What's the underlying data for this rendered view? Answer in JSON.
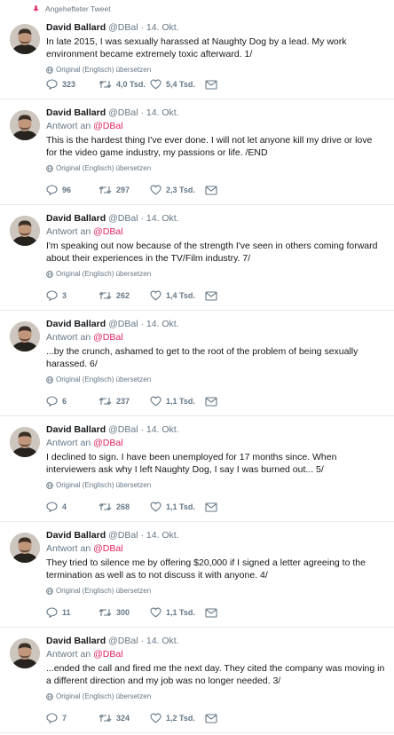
{
  "pinned_label": "Angehefteter Tweet",
  "reply_prefix": "Antwort an",
  "translate_label": "Original (Englisch) übersetzen",
  "accent_color": "#e0245e",
  "tweets": [
    {
      "name": "David Ballard",
      "meta": "@DBal · 14. Okt.",
      "reply_to": "",
      "text": "In late 2015, I was sexually harassed at Naughty Dog by a lead. My work environment became extremely toxic afterward. 1/",
      "replies": "323",
      "retweets": "4,0 Tsd.",
      "likes": "5,4 Tsd."
    },
    {
      "name": "David Ballard",
      "meta": "@DBal · 14. Okt.",
      "reply_to": "@DBal",
      "text": "This is the hardest thing I've ever done. I will not let anyone kill my drive or love for the video game industry, my passions or life. /END",
      "replies": "96",
      "retweets": "297",
      "likes": "2,3 Tsd."
    },
    {
      "name": "David Ballard",
      "meta": "@DBal · 14. Okt.",
      "reply_to": "@DBal",
      "text": "I'm speaking out now because of the strength I've seen in others coming forward about their experiences in the TV/Film industry. 7/",
      "replies": "3",
      "retweets": "262",
      "likes": "1,4 Tsd."
    },
    {
      "name": "David Ballard",
      "meta": "@DBal · 14. Okt.",
      "reply_to": "@DBal",
      "text": "...by the crunch, ashamed to get to the root of the problem of being sexually harassed. 6/",
      "replies": "6",
      "retweets": "237",
      "likes": "1,1 Tsd."
    },
    {
      "name": "David Ballard",
      "meta": "@DBal · 14. Okt.",
      "reply_to": "@DBal",
      "text": "I declined to sign. I have been unemployed for 17 months since. When interviewers ask why I left Naughty Dog, I say I was burned out... 5/",
      "replies": "4",
      "retweets": "268",
      "likes": "1,1 Tsd."
    },
    {
      "name": "David Ballard",
      "meta": "@DBal · 14. Okt.",
      "reply_to": "@DBal",
      "text": "They tried to silence me by offering $20,000 if I signed a letter agreeing to the termination as well as to not discuss it with anyone. 4/",
      "replies": "11",
      "retweets": "300",
      "likes": "1,1 Tsd."
    },
    {
      "name": "David Ballard",
      "meta": "@DBal · 14. Okt.",
      "reply_to": "@DBal",
      "text": "...ended the call and fired me the next day. They cited the company was moving in a different direction and my job was no longer needed. 3/",
      "replies": "7",
      "retweets": "324",
      "likes": "1,2 Tsd."
    }
  ]
}
